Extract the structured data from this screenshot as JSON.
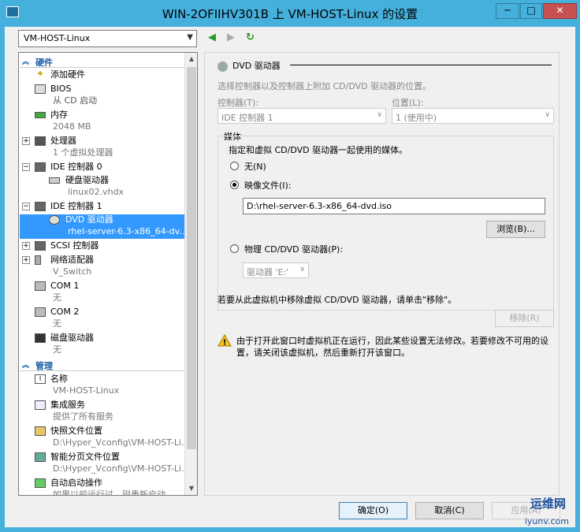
{
  "window": {
    "title": "WIN-2OFIIHV301B 上 VM-HOST-Linux 的设置",
    "minimize": "─",
    "maximize": "□",
    "close": "✕"
  },
  "vm_select": {
    "value": "VM-HOST-Linux"
  },
  "tree": {
    "hardware_header": "硬件",
    "management_header": "管理",
    "items": [
      {
        "name": "添加硬件",
        "sub": ""
      },
      {
        "name": "BIOS",
        "sub": "从 CD 启动"
      },
      {
        "name": "内存",
        "sub": "2048 MB"
      },
      {
        "name": "处理器",
        "sub": "1 个虚拟处理器"
      },
      {
        "name": "IDE 控制器 0",
        "sub": ""
      },
      {
        "name": "硬盘驱动器",
        "sub": "linux02.vhdx"
      },
      {
        "name": "IDE 控制器 1",
        "sub": ""
      },
      {
        "name": "DVD 驱动器",
        "sub": "rhel-server-6.3-x86_64-dv..."
      },
      {
        "name": "SCSI 控制器",
        "sub": ""
      },
      {
        "name": "网络适配器",
        "sub": "V_Switch"
      },
      {
        "name": "COM 1",
        "sub": "无"
      },
      {
        "name": "COM 2",
        "sub": "无"
      },
      {
        "name": "磁盘驱动器",
        "sub": "无"
      }
    ],
    "mgmt_items": [
      {
        "name": "名称",
        "sub": "VM-HOST-Linux"
      },
      {
        "name": "集成服务",
        "sub": "提供了所有服务"
      },
      {
        "name": "快照文件位置",
        "sub": "D:\\Hyper_Vconfig\\VM-HOST-Li..."
      },
      {
        "name": "智能分页文件位置",
        "sub": "D:\\Hyper_Vconfig\\VM-HOST-Li..."
      },
      {
        "name": "自动启动操作",
        "sub": "如果以前运行过，则重新启动"
      }
    ]
  },
  "panel": {
    "title": "DVD 驱动器",
    "desc": "选择控制器以及控制器上附加 CD/DVD 驱动器的位置。",
    "controller_label": "控制器(T):",
    "controller_value": "IDE 控制器 1",
    "location_label": "位置(L):",
    "location_value": "1 (使用中)",
    "media_label": "媒体",
    "media_desc": "指定和虚拟 CD/DVD 驱动器一起使用的媒体。",
    "none_label": "无(N)",
    "image_label": "映像文件(I):",
    "image_path": "D:\\rhel-server-6.3-x86_64-dvd.iso",
    "browse_label": "浏览(B)...",
    "physical_label": "物理 CD/DVD 驱动器(P):",
    "physical_value": "驱动器 'E:'",
    "remove_desc": "若要从此虚拟机中移除虚拟 CD/DVD 驱动器，请单击\"移除\"。",
    "remove_label": "移除(R)",
    "warning": "由于打开此窗口时虚拟机正在运行，因此某些设置无法修改。若要修改不可用的设置，请关闭该虚拟机，然后重新打开该窗口。"
  },
  "footer": {
    "ok": "确定(O)",
    "cancel": "取消(C)",
    "apply": "应用(A)"
  },
  "watermark": {
    "brand": "运维网",
    "site": "iyunv.com"
  }
}
